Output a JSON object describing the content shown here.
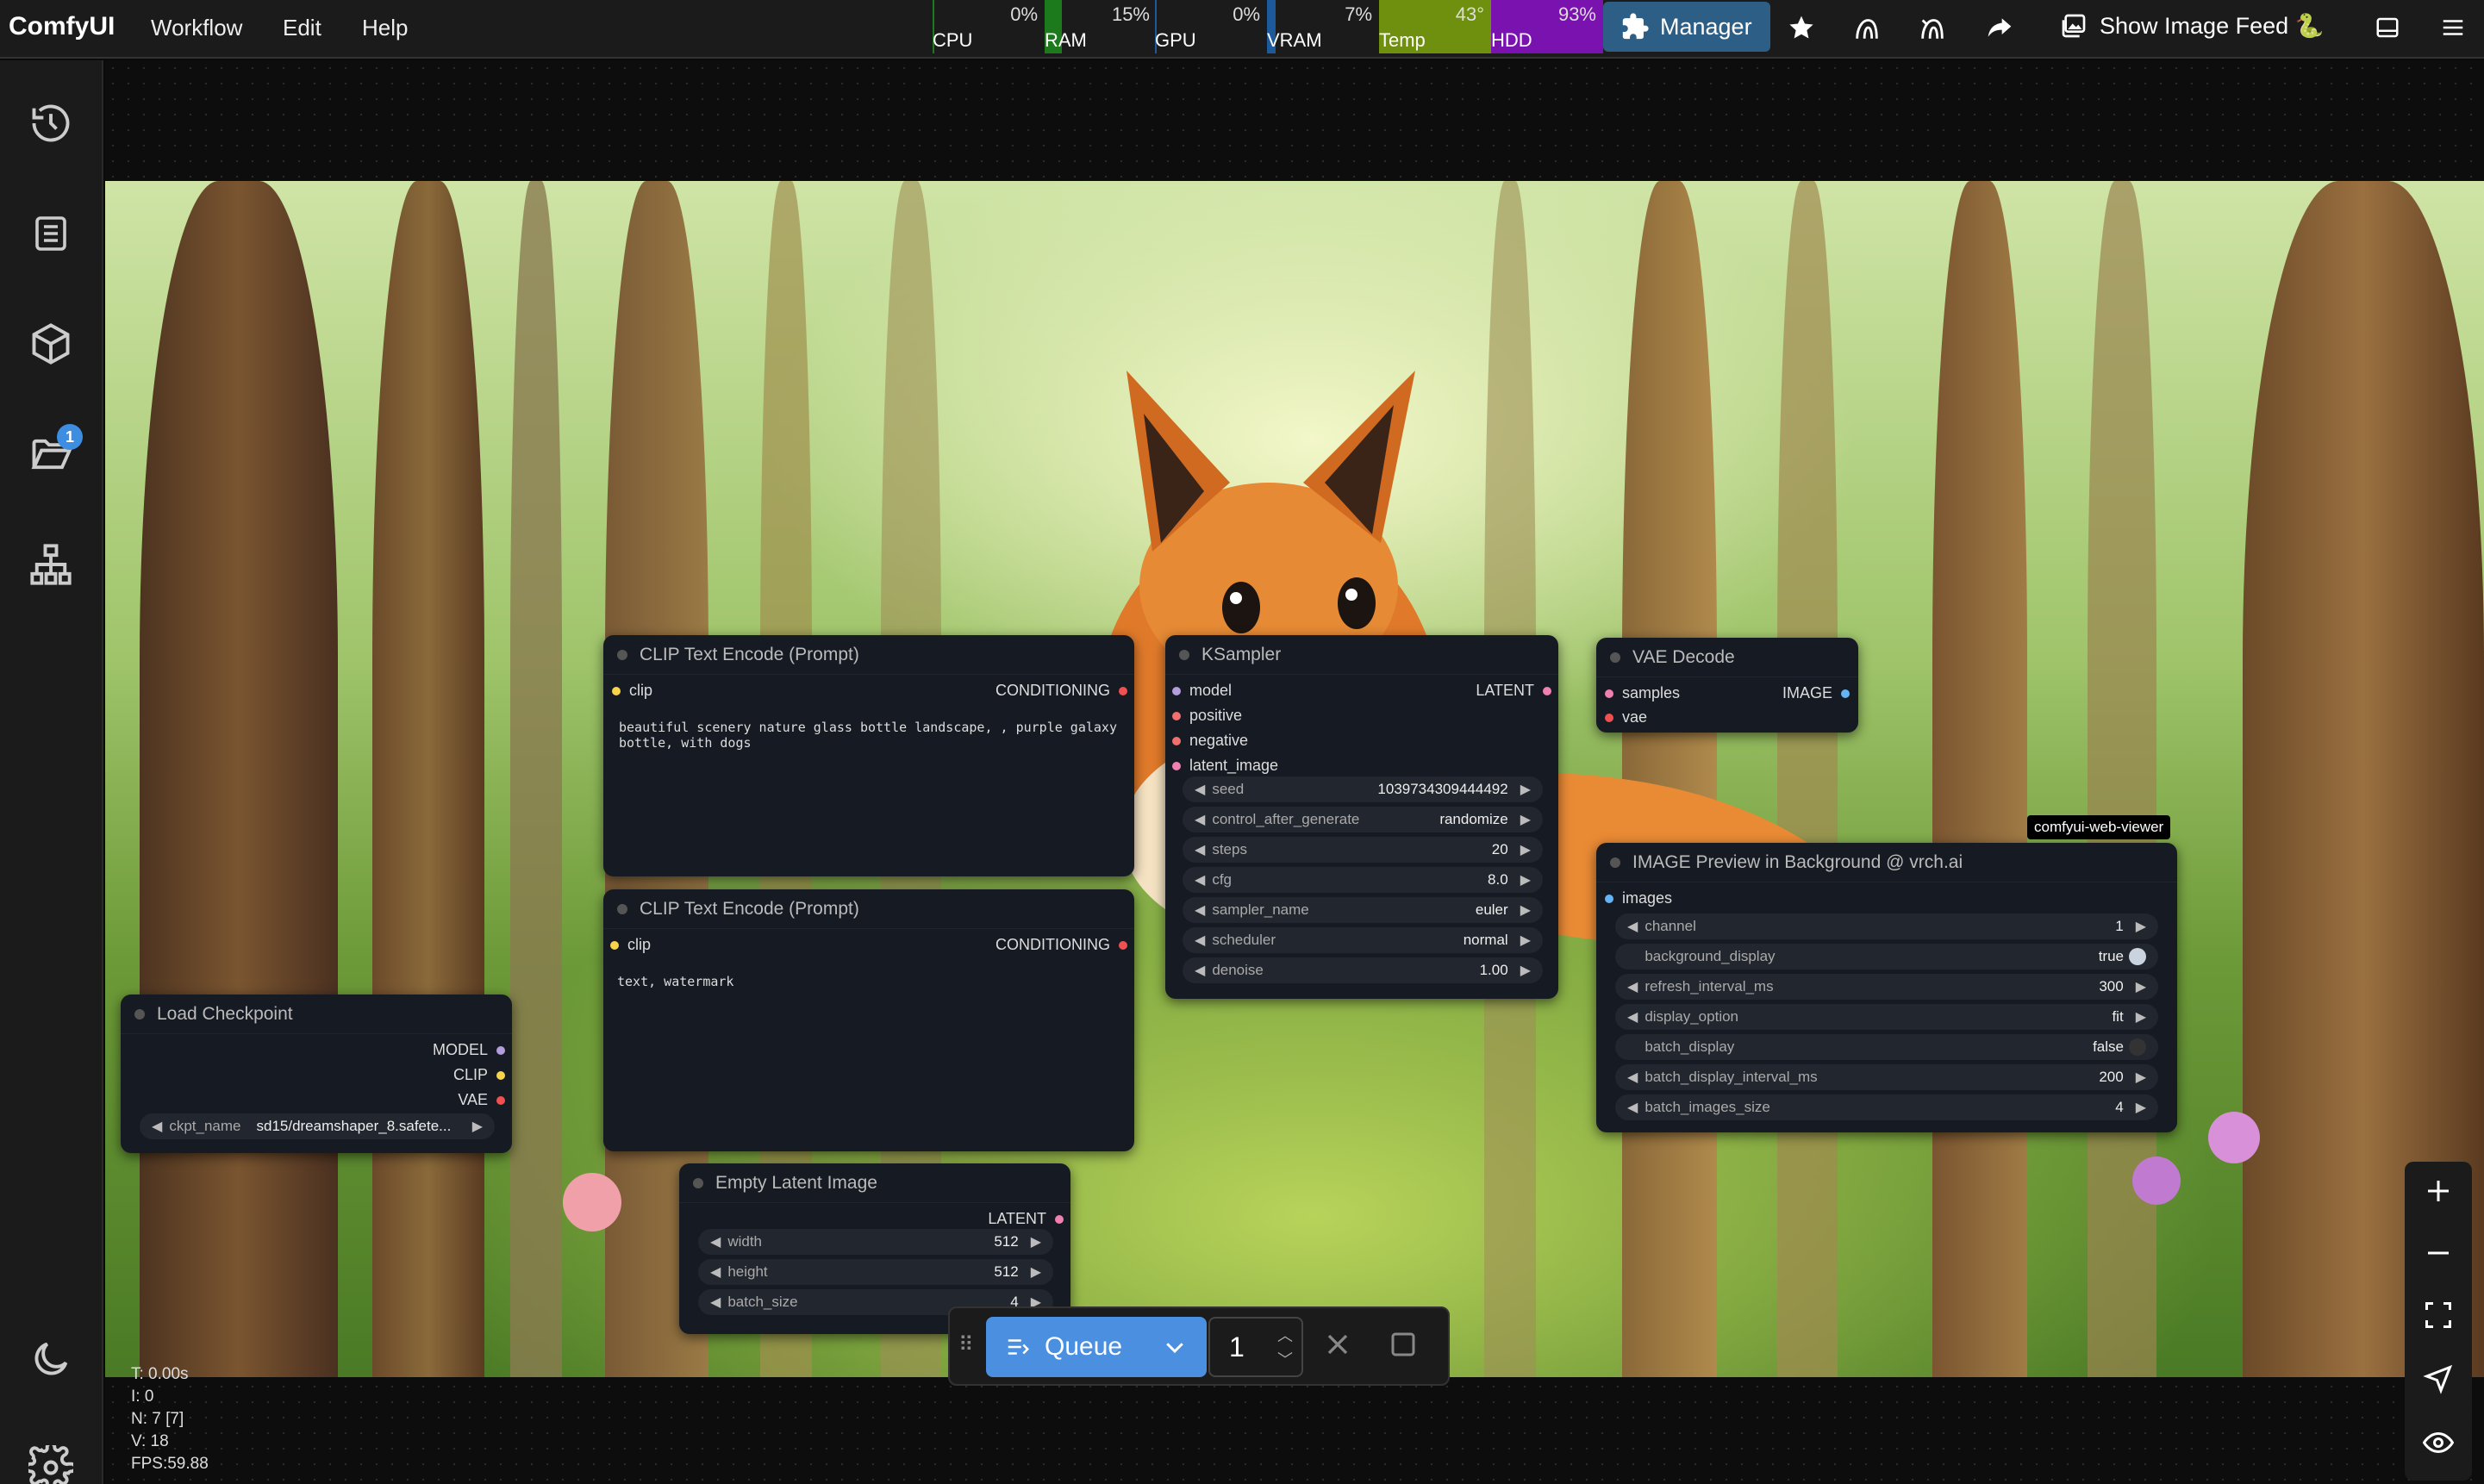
{
  "app": {
    "brand": "ComfyUI",
    "menu": [
      "Workflow",
      "Edit",
      "Help"
    ]
  },
  "monitor": [
    {
      "label": "CPU",
      "value": "0%",
      "fill": 0,
      "color": "#1c7a1c"
    },
    {
      "label": "RAM",
      "value": "15%",
      "fill": 0.15,
      "color": "#1c7a1c"
    },
    {
      "label": "GPU",
      "value": "0%",
      "fill": 0,
      "color": "#1c5a9c"
    },
    {
      "label": "VRAM",
      "value": "7%",
      "fill": 0.07,
      "color": "#1c5a9c"
    },
    {
      "label": "Temp",
      "value": "43°",
      "fill": 1,
      "color": "#6f8f0f"
    },
    {
      "label": "HDD",
      "value": "93%",
      "fill": 1,
      "color": "#7a12b0"
    }
  ],
  "toolbar": {
    "manager_label": "Manager",
    "feed_label": "Show Image Feed 🐍"
  },
  "sidebar": {
    "badge": "1",
    "icons": [
      "history-icon",
      "document-icon",
      "cube-icon",
      "folder-icon",
      "node-tree-icon"
    ]
  },
  "nodes": {
    "clip1": {
      "title": "CLIP Text Encode (Prompt)",
      "in": "clip",
      "out": "CONDITIONING",
      "text": "beautiful scenery nature glass bottle landscape, , purple galaxy\nbottle, with dogs"
    },
    "clip2": {
      "title": "CLIP Text Encode (Prompt)",
      "in": "clip",
      "out": "CONDITIONING",
      "text": "text, watermark"
    },
    "ksampler": {
      "title": "KSampler",
      "inputs": [
        "model",
        "positive",
        "negative",
        "latent_image"
      ],
      "out": "LATENT",
      "widgets": [
        {
          "name": "seed",
          "value": "1039734309444492"
        },
        {
          "name": "control_after_generate",
          "value": "randomize"
        },
        {
          "name": "steps",
          "value": "20"
        },
        {
          "name": "cfg",
          "value": "8.0"
        },
        {
          "name": "sampler_name",
          "value": "euler"
        },
        {
          "name": "scheduler",
          "value": "normal"
        },
        {
          "name": "denoise",
          "value": "1.00"
        }
      ]
    },
    "vae": {
      "title": "VAE Decode",
      "inputs": [
        "samples",
        "vae"
      ],
      "out": "IMAGE"
    },
    "preview": {
      "tag": "comfyui-web-viewer",
      "title": "IMAGE Preview in Background @ vrch.ai",
      "input": "images",
      "widgets": [
        {
          "name": "channel",
          "value": "1"
        },
        {
          "name": "background_display",
          "value": "true"
        },
        {
          "name": "refresh_interval_ms",
          "value": "300"
        },
        {
          "name": "display_option",
          "value": "fit"
        },
        {
          "name": "batch_display",
          "value": "false"
        },
        {
          "name": "batch_display_interval_ms",
          "value": "200"
        },
        {
          "name": "batch_images_size",
          "value": "4"
        }
      ]
    },
    "checkpoint": {
      "title": "Load Checkpoint",
      "outputs": [
        "MODEL",
        "CLIP",
        "VAE"
      ],
      "widget": {
        "name": "ckpt_name",
        "value": "sd15/dreamshaper_8.safete..."
      }
    },
    "latent": {
      "title": "Empty Latent Image",
      "out": "LATENT",
      "widgets": [
        {
          "name": "width",
          "value": "512"
        },
        {
          "name": "height",
          "value": "512"
        },
        {
          "name": "batch_size",
          "value": "4"
        }
      ]
    }
  },
  "queue": {
    "label": "Queue",
    "count": "1"
  },
  "stats": {
    "t": "T: 0.00s",
    "i": "I: 0",
    "n": "N: 7 [7]",
    "v": "V: 18",
    "fps": "FPS:59.88"
  }
}
